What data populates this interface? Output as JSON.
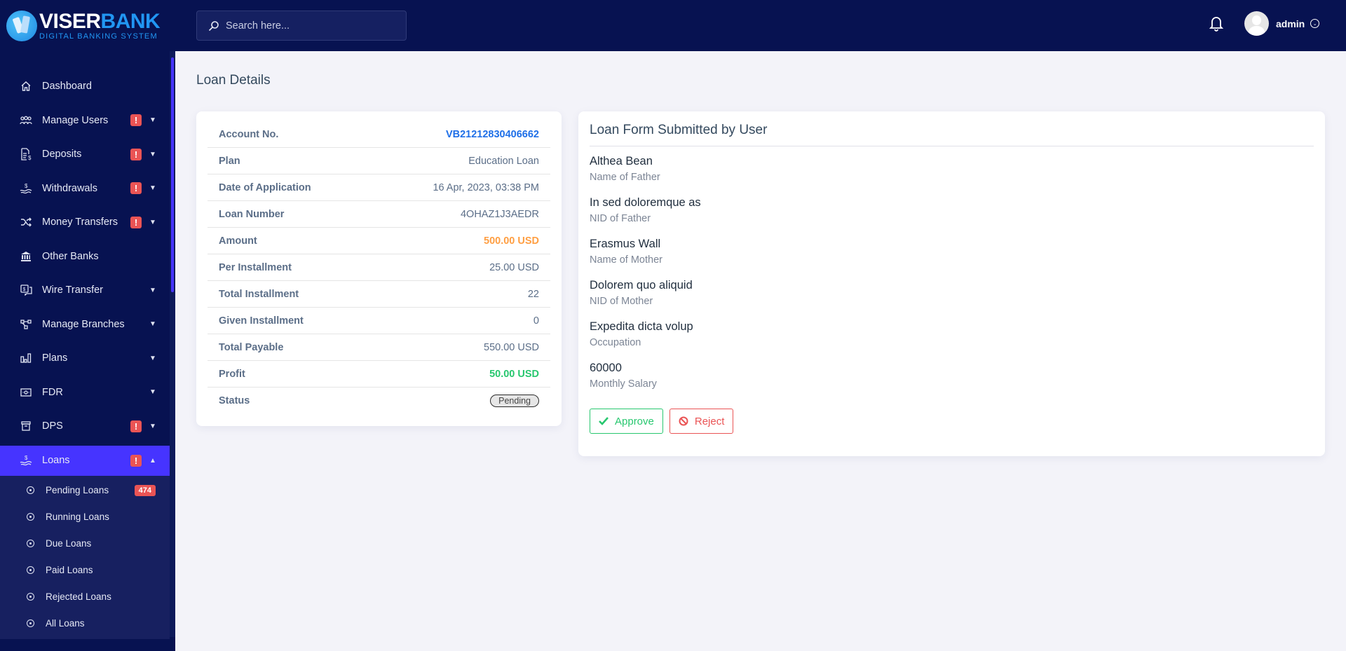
{
  "brand": {
    "title_white": "VISER",
    "title_blue": "BANK",
    "subtitle": "DIGITAL BANKING SYSTEM"
  },
  "colors": {
    "sidebar_bg": "#071251",
    "accent": "#4634ff",
    "alert": "#ea5455",
    "link_blue": "#1e6fe8",
    "amount_orange": "#ff9f43",
    "profit_green": "#28c76f"
  },
  "topbar": {
    "search_placeholder": "Search here...",
    "user_name": "admin"
  },
  "sidebar": {
    "items": [
      {
        "label": "Dashboard",
        "icon": "home-icon",
        "alert": false,
        "chevron": false
      },
      {
        "label": "Manage Users",
        "icon": "users-icon",
        "alert": true,
        "chevron": "down"
      },
      {
        "label": "Deposits",
        "icon": "deposit-icon",
        "alert": true,
        "chevron": "down"
      },
      {
        "label": "Withdrawals",
        "icon": "withdraw-icon",
        "alert": true,
        "chevron": "down"
      },
      {
        "label": "Money Transfers",
        "icon": "shuffle-icon",
        "alert": true,
        "chevron": "down"
      },
      {
        "label": "Other Banks",
        "icon": "bank-icon",
        "alert": false,
        "chevron": false
      },
      {
        "label": "Wire Transfer",
        "icon": "wire-transfer-icon",
        "alert": false,
        "chevron": "down"
      },
      {
        "label": "Manage Branches",
        "icon": "branches-icon",
        "alert": false,
        "chevron": "down"
      },
      {
        "label": "Plans",
        "icon": "chart-bar-icon",
        "alert": false,
        "chevron": "down"
      },
      {
        "label": "FDR",
        "icon": "money-bill-icon",
        "alert": false,
        "chevron": "down"
      },
      {
        "label": "DPS",
        "icon": "archive-icon",
        "alert": true,
        "chevron": "down"
      },
      {
        "label": "Loans",
        "icon": "loan-hand-icon",
        "alert": true,
        "chevron": "up",
        "active": true
      }
    ],
    "alert_glyph": "!",
    "loans_submenu": [
      {
        "label": "Pending Loans",
        "count": "474"
      },
      {
        "label": "Running Loans"
      },
      {
        "label": "Due Loans"
      },
      {
        "label": "Paid Loans"
      },
      {
        "label": "Rejected Loans"
      },
      {
        "label": "All Loans"
      }
    ]
  },
  "page": {
    "title": "Loan Details"
  },
  "loan_details": [
    {
      "key": "Account No.",
      "value": "VB21212830406662",
      "style": "blue"
    },
    {
      "key": "Plan",
      "value": "Education Loan"
    },
    {
      "key": "Date of Application",
      "value": "16 Apr, 2023, 03:38 PM"
    },
    {
      "key": "Loan Number",
      "value": "4OHAZ1J3AEDR"
    },
    {
      "key": "Amount",
      "value": "500.00 USD",
      "style": "orange"
    },
    {
      "key": "Per Installment",
      "value": "25.00 USD"
    },
    {
      "key": "Total Installment",
      "value": "22"
    },
    {
      "key": "Given Installment",
      "value": "0"
    },
    {
      "key": "Total Payable",
      "value": "550.00 USD"
    },
    {
      "key": "Profit",
      "value": "50.00 USD",
      "style": "green"
    },
    {
      "key": "Status",
      "value": "Pending",
      "style": "badge"
    }
  ],
  "loan_form": {
    "title": "Loan Form Submitted by User",
    "fields": [
      {
        "value": "Althea Bean",
        "label": "Name of Father"
      },
      {
        "value": "In sed doloremque as",
        "label": "NID of Father"
      },
      {
        "value": "Erasmus Wall",
        "label": "Name of Mother"
      },
      {
        "value": "Dolorem quo aliquid",
        "label": "NID of Mother"
      },
      {
        "value": "Expedita dicta volup",
        "label": "Occupation"
      },
      {
        "value": "60000",
        "label": "Monthly Salary"
      }
    ],
    "approve_label": "Approve",
    "reject_label": "Reject"
  }
}
